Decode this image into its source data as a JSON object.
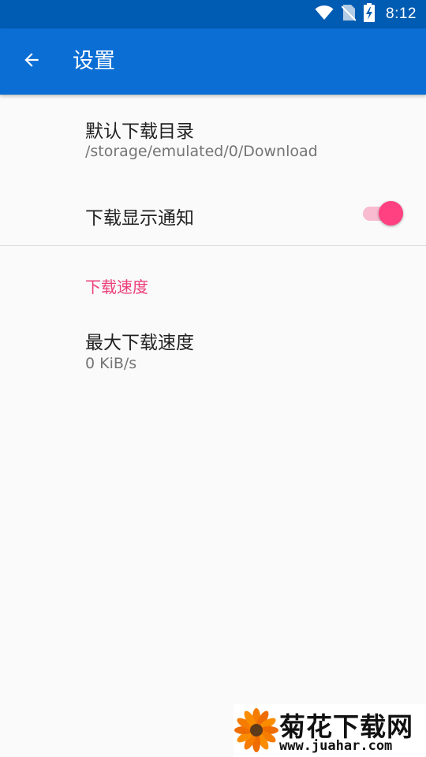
{
  "status_bar": {
    "time": "8:12",
    "icons": [
      "wifi-icon",
      "no-sim-icon",
      "battery-charging-icon"
    ]
  },
  "app_bar": {
    "title": "设置",
    "back_icon": "arrow-back-icon"
  },
  "preferences": {
    "download_dir": {
      "title": "默认下载目录",
      "summary": "/storage/emulated/0/Download"
    },
    "download_notification": {
      "title": "下载显示通知",
      "enabled": true
    },
    "speed_category": {
      "title": "下载速度"
    },
    "max_speed": {
      "title": "最大下载速度",
      "summary": "0 KiB/s"
    }
  },
  "watermark": {
    "name": "菊花下载网",
    "url": "www.juahar.com"
  },
  "colors": {
    "status_bar": "#005cb2",
    "app_bar": "#0b6ed4",
    "accent": "#ff4081",
    "category": "#ec407a",
    "background": "#fafafa"
  }
}
